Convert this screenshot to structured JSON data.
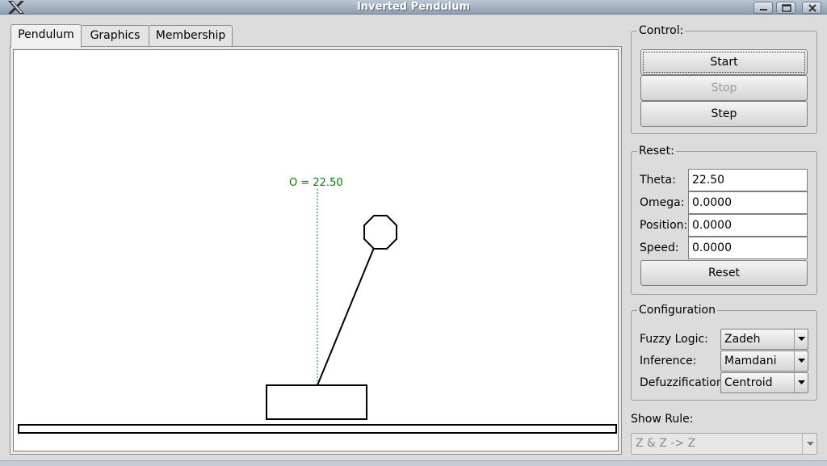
{
  "window": {
    "title": "Inverted Pendulum"
  },
  "tabs": [
    {
      "label": "Pendulum",
      "active": true
    },
    {
      "label": "Graphics",
      "active": false
    },
    {
      "label": "Membership",
      "active": false
    }
  ],
  "canvas": {
    "angle_label": "O = 22.50",
    "theta_degrees": 22.5,
    "colors": {
      "angle_guide": "#008000",
      "pendulum": "#000000",
      "background": "#ffffff"
    }
  },
  "control": {
    "title": "Control:",
    "start_label": "Start",
    "stop_label": "Stop",
    "step_label": "Step"
  },
  "reset": {
    "title": "Reset:",
    "theta_label": "Theta:",
    "theta_value": "22.50",
    "omega_label": "Omega:",
    "omega_value": "0.0000",
    "position_label": "Position:",
    "position_value": "0.0000",
    "speed_label": "Speed:",
    "speed_value": "0.0000",
    "reset_label": "Reset"
  },
  "configuration": {
    "title": "Configuration",
    "fuzzy_logic_label": "Fuzzy Logic:",
    "fuzzy_logic_value": "Zadeh",
    "inference_label": "Inference:",
    "inference_value": "Mamdani",
    "defuzzification_label": "Defuzzification:",
    "defuzzification_value": "Centroid"
  },
  "show_rule": {
    "label": "Show Rule:",
    "value": "Z & Z -> Z"
  },
  "icons": [
    "x-logo-icon",
    "minimize-icon",
    "maximize-icon",
    "close-icon",
    "chevron-down-icon"
  ]
}
